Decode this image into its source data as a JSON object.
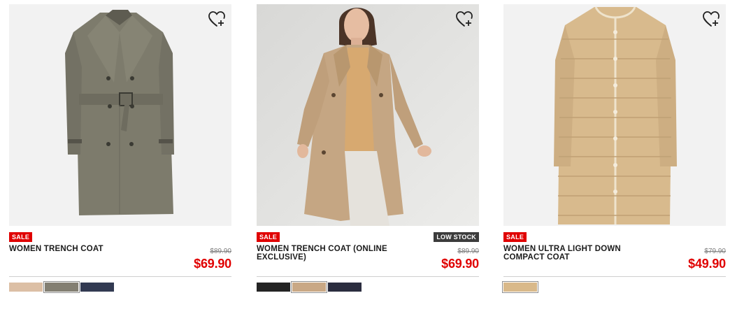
{
  "products": [
    {
      "name": "WOMEN TRENCH COAT",
      "badge_sale": "SALE",
      "badge_stock": "",
      "was_price": "$89.90",
      "price": "$69.90",
      "wishlist_icon": "heart-plus-icon",
      "swatches": [
        {
          "color": "#dcbfa5",
          "selected": false
        },
        {
          "color": "#837f72",
          "selected": true
        },
        {
          "color": "#323a52",
          "selected": false
        }
      ]
    },
    {
      "name": "WOMEN TRENCH COAT (ONLINE EXCLUSIVE)",
      "badge_sale": "SALE",
      "badge_stock": "LOW STOCK",
      "was_price": "$89.90",
      "price": "$69.90",
      "wishlist_icon": "heart-plus-icon",
      "swatches": [
        {
          "color": "#242424",
          "selected": false
        },
        {
          "color": "#c9a885",
          "selected": true
        },
        {
          "color": "#2b2d3f",
          "selected": false
        }
      ]
    },
    {
      "name": "WOMEN ULTRA LIGHT DOWN COMPACT COAT",
      "badge_sale": "SALE",
      "badge_stock": "",
      "was_price": "$79.90",
      "price": "$49.90",
      "wishlist_icon": "heart-plus-icon",
      "swatches": [
        {
          "color": "#d9b98a",
          "selected": true
        }
      ]
    }
  ],
  "colors": {
    "sale_red": "#e00000",
    "low_stock_bg": "#3c3c3c",
    "image_bg": "#f1f1f1"
  }
}
